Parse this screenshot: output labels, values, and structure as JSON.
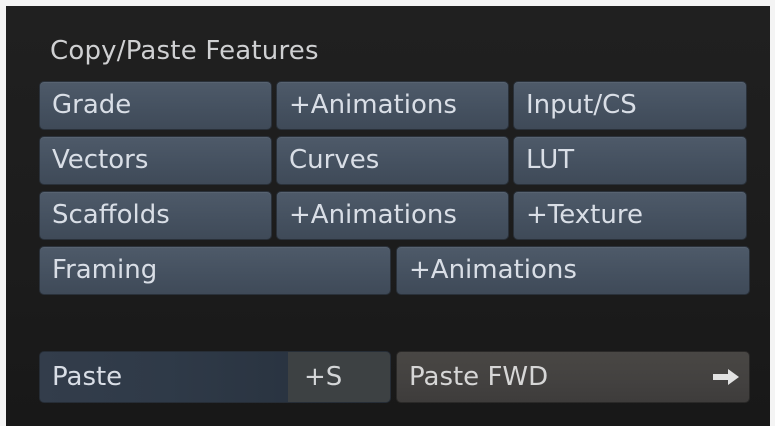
{
  "panel": {
    "title": "Copy/Paste Features"
  },
  "rows": [
    [
      "Grade",
      "+Animations",
      "Input/CS"
    ],
    [
      "Vectors",
      "Curves",
      "LUT"
    ],
    [
      "Scaffolds",
      "+Animations",
      "+Texture"
    ],
    [
      "Framing",
      "+Animations"
    ]
  ],
  "paste": {
    "label": "Paste",
    "modifier": "+S",
    "forward_label": "Paste FWD",
    "forward_icon": "arrow-right-icon"
  },
  "colors": {
    "button": "#4a5564",
    "paste_button": "#2f3a48",
    "paste_forward": "#464442",
    "background": "#1e1e1e"
  }
}
